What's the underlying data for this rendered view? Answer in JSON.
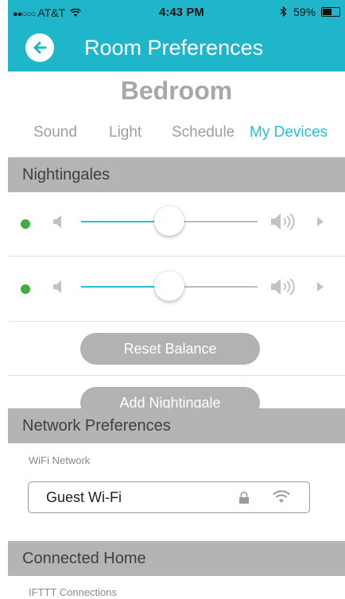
{
  "status_bar": {
    "signal_dots": "●●○○○",
    "carrier": "AT&T",
    "time": "4:43 PM",
    "battery_percent_text": "59%",
    "battery_level": 0.59
  },
  "header": {
    "title": "Room Preferences",
    "back_icon": "arrow-left-icon",
    "accent_color": "#1fb6cc"
  },
  "room": {
    "name": "Bedroom"
  },
  "tabs": [
    {
      "label": "Sound",
      "active": false
    },
    {
      "label": "Light",
      "active": false
    },
    {
      "label": "Schedule",
      "active": false
    },
    {
      "label": "My Devices",
      "active": true
    }
  ],
  "nightingales": {
    "section_title": "Nightingales",
    "devices": [
      {
        "status_color": "#3eae3a",
        "volume_level": 0.5
      },
      {
        "status_color": "#3eae3a",
        "volume_level": 0.5
      }
    ],
    "reset_label": "Reset Balance",
    "add_label": "Add Nightingale"
  },
  "network": {
    "section_title": "Network Preferences",
    "wifi_label": "WiFi Network",
    "wifi_value": "Guest Wi-Fi"
  },
  "connected_home": {
    "section_title": "Connected Home",
    "ifttt_label": "IFTTT Connections"
  }
}
